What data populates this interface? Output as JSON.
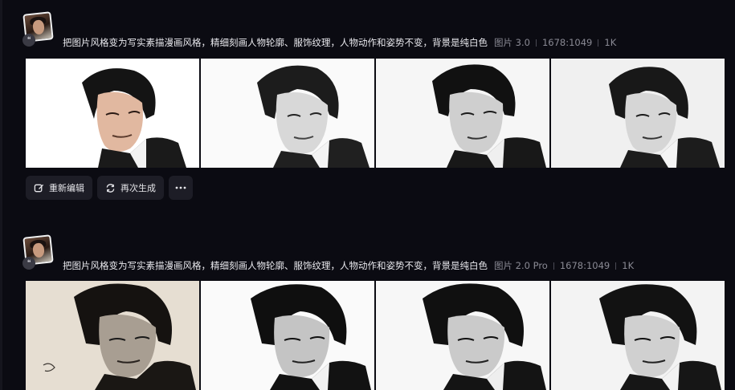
{
  "generations": [
    {
      "prompt": "把图片风格变为写实素描漫画风格，精细刻画人物轮廓、服饰纹理，人物动作和姿势不变，背景是纯白色",
      "model": "图片 3.0",
      "ratio": "1678:1049",
      "resolution": "1K",
      "images": [
        {
          "alt": "sketch portrait 1"
        },
        {
          "alt": "sketch portrait 2"
        },
        {
          "alt": "sketch portrait 3"
        },
        {
          "alt": "sketch portrait 4"
        }
      ],
      "actions": {
        "edit_label": "重新编辑",
        "regenerate_label": "再次生成"
      }
    },
    {
      "prompt": "把图片风格变为写实素描漫画风格，精细刻画人物轮廓、服饰纹理，人物动作和姿势不变，背景是纯白色",
      "model": "图片 2.0 Pro",
      "ratio": "1678:1049",
      "resolution": "1K",
      "images": [
        {
          "alt": "sketch portrait 1"
        },
        {
          "alt": "sketch portrait 2"
        },
        {
          "alt": "sketch portrait 3"
        },
        {
          "alt": "sketch portrait 4"
        }
      ]
    }
  ],
  "icons": {
    "quote": "quote-icon",
    "edit": "edit-icon",
    "regenerate": "refresh-icon",
    "more": "more-icon"
  },
  "colors": {
    "background": "#0b0b12",
    "button": "#1d1d26",
    "meta_text": "#8a8a94"
  }
}
